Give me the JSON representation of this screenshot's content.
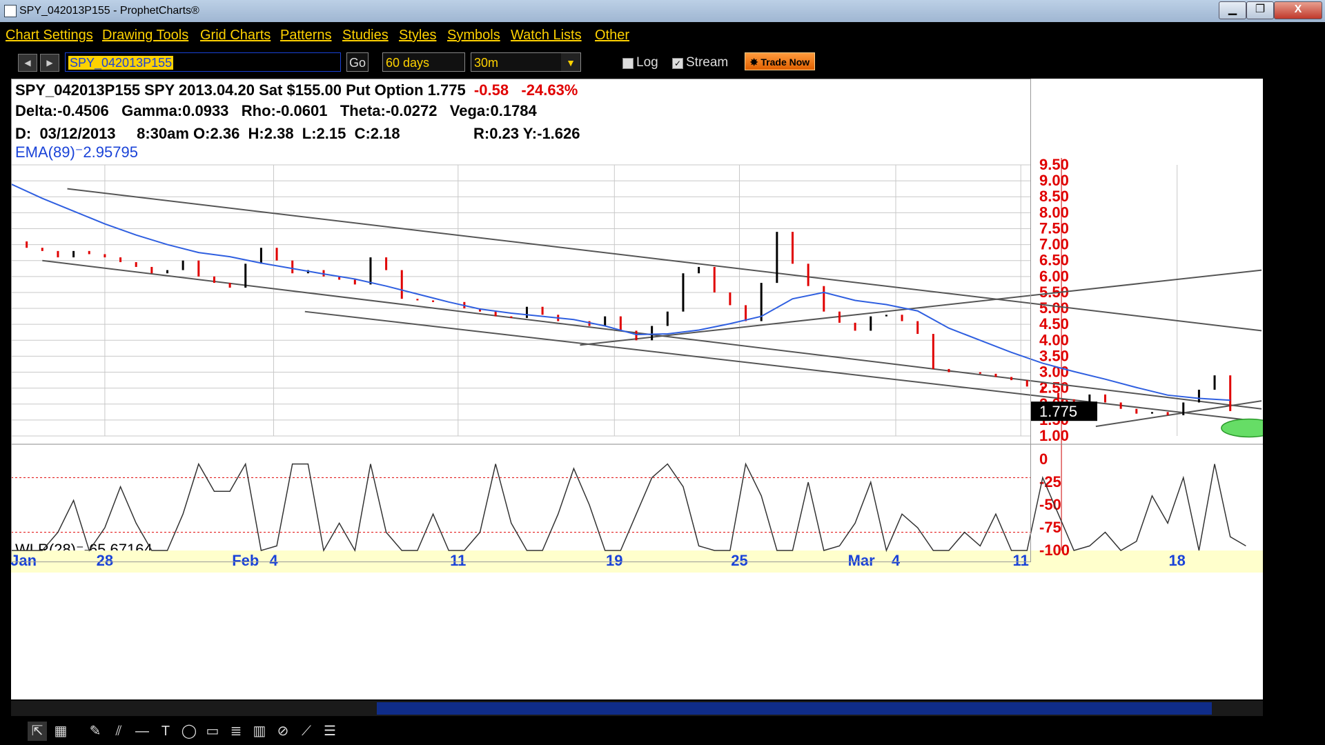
{
  "window": {
    "title": "SPY_042013P155 - ProphetCharts®",
    "min_label": "▁",
    "max_label": "❐",
    "close_label": "X"
  },
  "menu": [
    "Chart Settings",
    "Drawing Tools",
    "Grid Charts",
    "Patterns",
    "Studies",
    "Styles",
    "Symbols",
    "Watch Lists",
    "Other"
  ],
  "toolbar": {
    "symbol_value": "SPY_042013P155",
    "go_label": "Go",
    "range_value": "60 days",
    "interval_value": "30m",
    "log_label": "Log",
    "stream_label": "Stream",
    "stream_checked": "✓",
    "trade_now_label": "Trade Now",
    "prev_label": "◀",
    "next_label": "▶"
  },
  "header": {
    "line1_main": "SPY_042013P155 SPY 2013.04.20 Sat $155.00 Put Option  1.775",
    "line1_change": "-0.58",
    "line1_pct": "-24.63%",
    "delta": "Delta:-0.4506",
    "gamma": "Gamma:0.0933",
    "rho": "Rho:-0.0601",
    "theta": "Theta:-0.0272",
    "vega": "Vega:0.1784",
    "ohlc": "D:  03/12/2013     8:30am O:2.36  H:2.38  L:2.15  C:2.18",
    "ry": "R:0.23  Y:-1.626",
    "ema": "EMA(89)⁻2.95795",
    "wlr": "WLR(28)⁻-65.67164"
  },
  "colors": {
    "ema": "#2f5fe0",
    "up": "#000000",
    "down": "#e00000",
    "grid": "#c8c8c8",
    "marker": "#66dd66"
  },
  "chart_data": [
    {
      "type": "line",
      "title": "SPY_042013P155 SPY 2013.04.20 Sat $155.00 Put Option",
      "ylim": [
        1.0,
        9.5
      ],
      "yticks": [
        "9.50",
        "9.00",
        "8.50",
        "8.00",
        "7.50",
        "7.00",
        "6.50",
        "6.00",
        "5.50",
        "5.00",
        "4.50",
        "4.00",
        "3.50",
        "3.00",
        "2.50",
        "2.00",
        "1.50",
        "1.00"
      ],
      "last_price": "1.775",
      "x_labels": [
        {
          "label": "Jan",
          "day": 0.4
        },
        {
          "label": "28",
          "day": 3
        },
        {
          "label": "Feb",
          "day": 7.5
        },
        {
          "label": "4",
          "day": 8.4
        },
        {
          "label": "11",
          "day": 14.3
        },
        {
          "label": "19",
          "day": 19.3
        },
        {
          "label": "25",
          "day": 23.3
        },
        {
          "label": "Mar",
          "day": 27.2
        },
        {
          "label": "4",
          "day": 28.3
        },
        {
          "label": "11",
          "day": 32.3
        },
        {
          "label": "18",
          "day": 37.3
        }
      ],
      "cursor_day": 33.6,
      "series": [
        {
          "name": "EMA(89)",
          "x": [
            0,
            1,
            2,
            3,
            4,
            5,
            6,
            7,
            8,
            9,
            10,
            11,
            12,
            13,
            14,
            15,
            16,
            17,
            18,
            19,
            20,
            21,
            22,
            23,
            24,
            25,
            26,
            27,
            28,
            29,
            30,
            31,
            32,
            33,
            34,
            35,
            36,
            37,
            38,
            39
          ],
          "values": [
            8.9,
            8.45,
            8.05,
            7.65,
            7.3,
            7.0,
            6.75,
            6.62,
            6.42,
            6.25,
            6.08,
            5.92,
            5.7,
            5.45,
            5.2,
            4.98,
            4.85,
            4.75,
            4.65,
            4.45,
            4.18,
            4.2,
            4.32,
            4.52,
            4.75,
            5.3,
            5.5,
            5.25,
            5.12,
            4.92,
            4.38,
            4.0,
            3.62,
            3.28,
            3.02,
            2.78,
            2.52,
            2.28,
            2.18,
            2.12
          ]
        },
        {
          "name": "Price",
          "x": [
            0,
            0.5,
            1,
            1.5,
            2,
            2.5,
            3,
            3.5,
            4,
            4.5,
            5,
            5.5,
            6,
            6.5,
            7,
            7.5,
            8,
            8.5,
            9,
            9.5,
            10,
            10.5,
            11,
            11.5,
            12,
            12.5,
            13,
            13.5,
            14,
            14.5,
            15,
            15.5,
            16,
            16.5,
            17,
            17.5,
            18,
            18.5,
            19,
            19.5,
            20,
            20.5,
            21,
            21.5,
            22,
            22.5,
            23,
            23.5,
            24,
            24.5,
            25,
            25.5,
            26,
            26.5,
            27,
            27.5,
            28,
            28.5,
            29,
            29.5,
            30,
            30.5,
            31,
            31.5,
            32,
            32.5,
            33,
            33.5,
            34,
            34.5,
            35,
            35.5,
            36,
            36.5,
            37,
            37.5,
            38,
            38.5,
            39
          ],
          "values": [
            7.1,
            6.9,
            6.8,
            6.6,
            6.8,
            6.7,
            6.6,
            6.45,
            6.3,
            6.1,
            6.2,
            6.5,
            6.0,
            5.8,
            5.65,
            6.4,
            6.9,
            6.5,
            6.1,
            6.2,
            6.0,
            5.9,
            5.75,
            6.6,
            6.2,
            5.3,
            5.25,
            5.2,
            5.2,
            5.0,
            4.9,
            4.75,
            4.7,
            5.05,
            4.8,
            4.6,
            4.6,
            4.45,
            4.75,
            4.3,
            4.0,
            4.45,
            4.9,
            6.1,
            6.3,
            5.5,
            5.1,
            4.6,
            5.8,
            7.4,
            6.4,
            5.7,
            4.9,
            4.55,
            4.3,
            4.75,
            4.8,
            4.6,
            4.2,
            3.1,
            3.0,
            3.0,
            2.95,
            2.85,
            2.75,
            2.55,
            2.35,
            2.15,
            1.95,
            2.3,
            2.05,
            1.85,
            1.7,
            1.75,
            1.65,
            2.05,
            2.45,
            2.9,
            1.78
          ]
        }
      ],
      "trendlines": [
        {
          "from": [
            1.8,
            8.75
          ],
          "to": [
            40,
            4.3
          ]
        },
        {
          "from": [
            1.0,
            6.5
          ],
          "to": [
            40,
            1.85
          ]
        },
        {
          "from": [
            9.4,
            4.9
          ],
          "to": [
            40,
            1.45
          ]
        },
        {
          "from": [
            18.2,
            3.85
          ],
          "to": [
            40,
            6.2
          ]
        },
        {
          "from": [
            34.7,
            1.3
          ],
          "to": [
            40,
            2.1
          ]
        }
      ]
    },
    {
      "type": "line",
      "title": "WLR(28)",
      "ylim": [
        -100,
        0
      ],
      "yticks": [
        "0",
        "-25",
        "-50",
        "-75",
        "-100"
      ],
      "reference_lines": [
        -20,
        -80
      ],
      "series": [
        {
          "name": "WLR(28)",
          "x": [
            0,
            1,
            1.5,
            2,
            2.5,
            3,
            3.5,
            4,
            4.5,
            5,
            5.5,
            6,
            6.5,
            7,
            7.5,
            8,
            8.5,
            9,
            9.5,
            10,
            10.5,
            11,
            11.5,
            12,
            12.5,
            13,
            13.5,
            14,
            14.5,
            15,
            15.5,
            16,
            16.5,
            17,
            17.5,
            18,
            18.5,
            19,
            19.5,
            20,
            20.5,
            21,
            21.5,
            22,
            22.5,
            23,
            23.5,
            24,
            24.5,
            25,
            25.5,
            26,
            26.5,
            27,
            27.5,
            28,
            28.5,
            29,
            29.5,
            30,
            30.5,
            31,
            31.5,
            32,
            32.5,
            33,
            33.5,
            34,
            34.5,
            35,
            35.5,
            36,
            36.5,
            37,
            37.5,
            38,
            38.5,
            39,
            39.5
          ],
          "values": [
            -100,
            -100,
            -80,
            -45,
            -100,
            -75,
            -30,
            -70,
            -100,
            -100,
            -60,
            -5,
            -35,
            -35,
            -5,
            -100,
            -95,
            -5,
            -5,
            -100,
            -70,
            -100,
            -5,
            -80,
            -100,
            -100,
            -60,
            -100,
            -100,
            -80,
            -5,
            -70,
            -100,
            -100,
            -60,
            -10,
            -50,
            -100,
            -100,
            -60,
            -20,
            -5,
            -30,
            -95,
            -100,
            -100,
            -5,
            -40,
            -100,
            -100,
            -25,
            -100,
            -95,
            -70,
            -25,
            -100,
            -60,
            -75,
            -100,
            -100,
            -80,
            -95,
            -60,
            -100,
            -100,
            -20,
            -60,
            -100,
            -95,
            -80,
            -100,
            -90,
            -40,
            -70,
            -20,
            -100,
            -5,
            -85,
            -95
          ]
        }
      ]
    }
  ]
}
